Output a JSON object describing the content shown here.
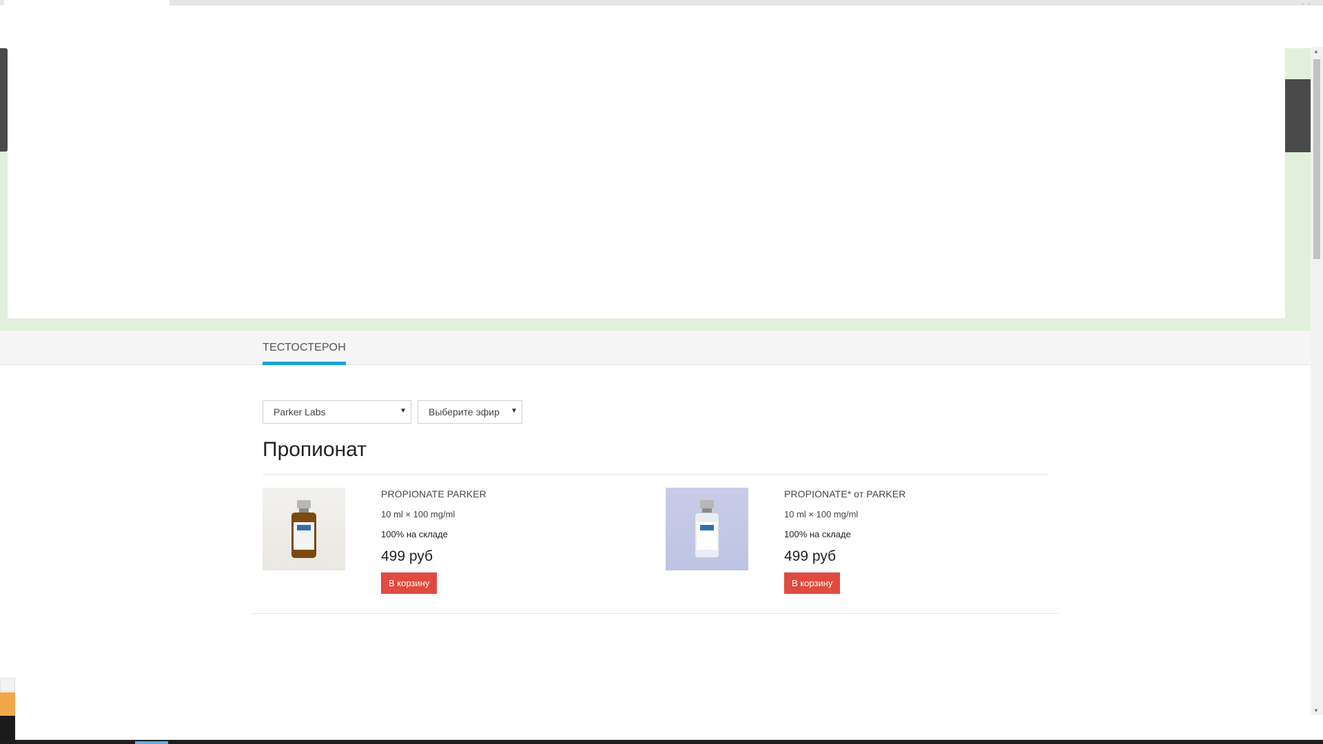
{
  "window": {
    "controls_label": "· ·"
  },
  "category_tabs": [
    {
      "label": "ТЕСТОСТЕРОН",
      "active": true
    }
  ],
  "filters": {
    "brand": {
      "selected": "Parker Labs"
    },
    "ether": {
      "selected": "Выберите эфир"
    }
  },
  "section": {
    "title": "Пропионат"
  },
  "products": [
    {
      "name": "PROPIONATE PARKER",
      "dose": "10 ml × 100 mg/ml",
      "stock": "100% на складе",
      "price": "499 руб",
      "cart_label": "В корзину"
    },
    {
      "name": "PROPIONATE* от PARKER",
      "dose": "10 ml × 100 mg/ml",
      "stock": "100% на складе",
      "price": "499 руб",
      "cart_label": "В корзину"
    }
  ],
  "colors": {
    "accent": "#1aa3d9",
    "cart_button": "#e04a3f",
    "hero_band": "#e1f0dc"
  },
  "icons": {
    "dropdown": "chevron-down-icon",
    "scroll_up": "arrow-up-icon",
    "scroll_down": "arrow-down-icon"
  }
}
